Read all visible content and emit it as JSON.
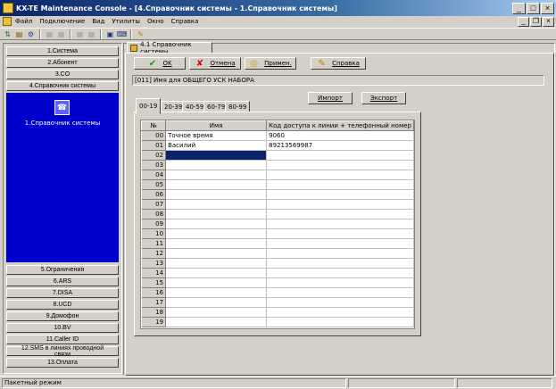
{
  "window": {
    "title": "KX-TE Maintenance Console - [4.Справочник системы - 1.Справочник системы]"
  },
  "menu": {
    "items": [
      "Файл",
      "Подключение",
      "Вид",
      "Утилиты",
      "Окно",
      "Справка"
    ]
  },
  "nav": {
    "top": [
      "1.Система",
      "2.Абонент",
      "3.CO",
      "4.Справочник системы"
    ],
    "active": "1.Справочник системы",
    "bottom": [
      "5.Ограничения",
      "6.ARS",
      "7.DISA",
      "8.UCD",
      "9.Домофон",
      "10.BV",
      "11.Caller ID",
      "12.SMS в линиях проводной связи",
      "13.Оплата"
    ]
  },
  "doc_tab": {
    "label": "4.1 Справочник системы"
  },
  "buttons": {
    "ok": "OK",
    "cancel": "Отмена",
    "apply": "Примен.",
    "help": "Справка",
    "import": "Импорт",
    "export": "Экспорт"
  },
  "info": "[011] Имя для ОБЩЕГО УСК НАБОРА",
  "tabs": [
    "00-19",
    "20-39",
    "40-59",
    "60-79",
    "80-99"
  ],
  "table": {
    "headers": [
      "№",
      "Имя",
      "Код доступа к линии + телефонный номер"
    ],
    "rows": [
      {
        "no": "00",
        "name": "Точное время",
        "number": "9060"
      },
      {
        "no": "01",
        "name": "Василий",
        "number": "89213569987"
      },
      {
        "no": "02",
        "name": "",
        "number": ""
      },
      {
        "no": "03",
        "name": "",
        "number": ""
      },
      {
        "no": "04",
        "name": "",
        "number": ""
      },
      {
        "no": "05",
        "name": "",
        "number": ""
      },
      {
        "no": "06",
        "name": "",
        "number": ""
      },
      {
        "no": "07",
        "name": "",
        "number": ""
      },
      {
        "no": "08",
        "name": "",
        "number": ""
      },
      {
        "no": "09",
        "name": "",
        "number": ""
      },
      {
        "no": "10",
        "name": "",
        "number": ""
      },
      {
        "no": "11",
        "name": "",
        "number": ""
      },
      {
        "no": "12",
        "name": "",
        "number": ""
      },
      {
        "no": "13",
        "name": "",
        "number": ""
      },
      {
        "no": "14",
        "name": "",
        "number": ""
      },
      {
        "no": "15",
        "name": "",
        "number": ""
      },
      {
        "no": "16",
        "name": "",
        "number": ""
      },
      {
        "no": "17",
        "name": "",
        "number": ""
      },
      {
        "no": "18",
        "name": "",
        "number": ""
      },
      {
        "no": "19",
        "name": "",
        "number": ""
      }
    ],
    "selected_row": 2
  },
  "status": {
    "mode": "Пакетный режим"
  },
  "colors": {
    "nav_active": "#0000cc",
    "selection": "#0a246a",
    "title_start": "#0a246a"
  }
}
